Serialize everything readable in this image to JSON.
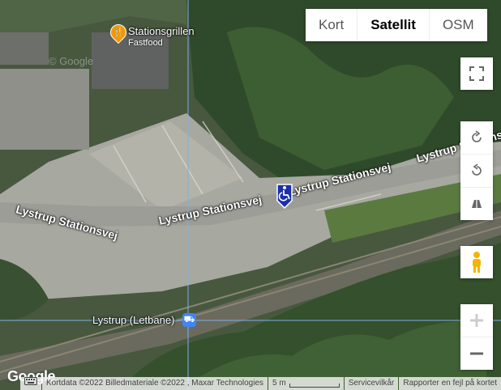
{
  "map": {
    "roads": [
      {
        "name": "Lystrup Stationsvej"
      },
      {
        "name": "Lystrup Stationsvej"
      },
      {
        "name": "Lystrup Stationsvej"
      },
      {
        "name": "Lystrup Stationsvej"
      }
    ],
    "poi": {
      "name": "Stationsgrillen",
      "category": "Fastfood"
    },
    "station": {
      "name": "Lystrup (Letbane)"
    },
    "accessibility_marker": "wheelchair-icon"
  },
  "map_type": {
    "options": [
      "Kort",
      "Satellit",
      "OSM"
    ],
    "selected": "Satellit"
  },
  "attribution": {
    "logo": "Google",
    "keyboard_icon": "keyboard-icon",
    "data": "Kortdata ©2022 Billedmateriale ©2022 , Maxar Technologies",
    "scale": "5 m",
    "terms": "Servicevilkår",
    "report": "Rapporter en fejl på kortet"
  },
  "colors": {
    "accent_blue": "#1a2fa8",
    "poi_orange": "#f29900",
    "transit_blue": "#4285f4"
  }
}
